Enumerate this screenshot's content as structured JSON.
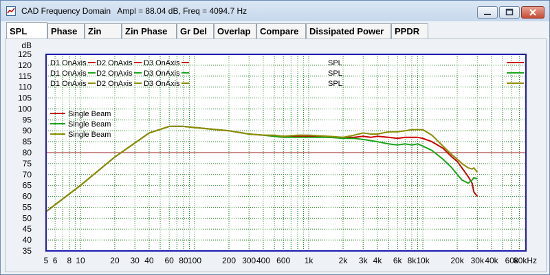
{
  "window": {
    "title": "CAD Frequency Domain   Ampl = 88.04 dB, Freq = 4094.7 Hz"
  },
  "tabs": [
    {
      "label": "SPL",
      "active": true
    },
    {
      "label": "Phase",
      "active": false
    },
    {
      "label": "Zin",
      "active": false
    },
    {
      "label": "Zin Phase",
      "active": false
    },
    {
      "label": "Gr Del",
      "active": false
    },
    {
      "label": "Overlap",
      "active": false
    },
    {
      "label": "Compare",
      "active": false
    },
    {
      "label": "Dissipated Power",
      "active": false
    },
    {
      "label": "PPDR",
      "active": false
    }
  ],
  "colors": {
    "red": "#cc0000",
    "green": "#1aa51a",
    "olive": "#8c8c00",
    "grid": "#157a15",
    "reference": "#9b1b1b",
    "frame": "#1c1cb0",
    "plot_bg": "#ffffff"
  },
  "chart_data": {
    "type": "line",
    "x_scale": "log",
    "xlim": [
      5,
      80000
    ],
    "ylim": [
      35,
      125
    ],
    "ylabel": "dB",
    "grid": true,
    "y_ticks": [
      35,
      40,
      45,
      50,
      55,
      60,
      65,
      70,
      75,
      80,
      85,
      90,
      95,
      100,
      105,
      110,
      115,
      120,
      125
    ],
    "x_tick_labels": [
      {
        "x": 5,
        "label": "5"
      },
      {
        "x": 6,
        "label": "6"
      },
      {
        "x": 8,
        "label": "8"
      },
      {
        "x": 10,
        "label": "10"
      },
      {
        "x": 20,
        "label": "20"
      },
      {
        "x": 30,
        "label": "30"
      },
      {
        "x": 40,
        "label": "40"
      },
      {
        "x": 60,
        "label": "60"
      },
      {
        "x": 80,
        "label": "80"
      },
      {
        "x": 100,
        "label": "100"
      },
      {
        "x": 200,
        "label": "200"
      },
      {
        "x": 300,
        "label": "300"
      },
      {
        "x": 400,
        "label": "400"
      },
      {
        "x": 600,
        "label": "600"
      },
      {
        "x": 1000,
        "label": "1k"
      },
      {
        "x": 2000,
        "label": "2k"
      },
      {
        "x": 3000,
        "label": "3k"
      },
      {
        "x": 4000,
        "label": "4k"
      },
      {
        "x": 6000,
        "label": "6k"
      },
      {
        "x": 8000,
        "label": "8k"
      },
      {
        "x": 10000,
        "label": "10k"
      },
      {
        "x": 20000,
        "label": "20k"
      },
      {
        "x": 30000,
        "label": "30k"
      },
      {
        "x": 40000,
        "label": "40k"
      },
      {
        "x": 60000,
        "label": "60k"
      },
      {
        "x": 80000,
        "label": "80kHz"
      }
    ],
    "reference_line": 80,
    "legend_top": [
      {
        "label": "D1 OnAxis - D2 OnAxis - D3 OnAxis",
        "right_label": "SPL",
        "color_key": "red"
      },
      {
        "label": "D1 OnAxis - D2 OnAxis - D3 OnAxis",
        "right_label": "SPL",
        "color_key": "green"
      },
      {
        "label": "D1 OnAxis - D2 OnAxis - D3 OnAxis",
        "right_label": "SPL",
        "color_key": "olive"
      }
    ],
    "legend_left": [
      {
        "label": "Single Beam",
        "color_key": "red"
      },
      {
        "label": "Single Beam",
        "color_key": "green"
      },
      {
        "label": "Single Beam",
        "color_key": "olive"
      }
    ],
    "series": [
      {
        "color_key": "red",
        "x": [
          5,
          10,
          20,
          40,
          60,
          80,
          100,
          200,
          300,
          400,
          500,
          600,
          800,
          1000,
          1500,
          2000,
          2500,
          3000,
          3500,
          4000,
          5000,
          6000,
          7000,
          8000,
          9000,
          10000,
          12000,
          15000,
          18000,
          20000,
          22000,
          25000,
          27000,
          28000,
          30000
        ],
        "y": [
          53,
          65,
          78,
          89,
          92,
          92,
          91.5,
          90,
          88.5,
          88,
          87.5,
          87,
          87.5,
          87.5,
          87,
          87,
          87,
          87.5,
          87,
          87.5,
          87,
          86.5,
          87,
          87,
          87,
          86.5,
          85,
          82,
          78,
          76,
          73,
          69,
          66,
          62,
          60
        ]
      },
      {
        "color_key": "green",
        "x": [
          5,
          10,
          20,
          40,
          60,
          80,
          100,
          200,
          300,
          400,
          500,
          600,
          800,
          1000,
          1500,
          2000,
          2500,
          3000,
          3500,
          4000,
          5000,
          6000,
          7000,
          8000,
          9000,
          10000,
          12000,
          15000,
          18000,
          20000,
          22000,
          25000,
          27000,
          28000,
          30000
        ],
        "y": [
          53,
          65,
          78,
          89,
          92,
          92,
          91.5,
          90,
          88.5,
          88,
          87.5,
          87,
          87,
          87,
          87,
          86.5,
          86.5,
          86,
          85.5,
          85,
          84,
          83.5,
          84,
          83.5,
          84,
          83,
          81,
          77,
          73,
          70,
          67.5,
          66,
          67.5,
          68.5,
          68
        ]
      },
      {
        "color_key": "olive",
        "x": [
          5,
          10,
          20,
          40,
          60,
          80,
          100,
          200,
          300,
          400,
          500,
          600,
          800,
          1000,
          1500,
          2000,
          2500,
          3000,
          3500,
          4000,
          5000,
          6000,
          7000,
          8000,
          9000,
          10000,
          12000,
          15000,
          18000,
          20000,
          22000,
          25000,
          27000,
          28000,
          30000
        ],
        "y": [
          53,
          65,
          78,
          89,
          92,
          92,
          91.5,
          90,
          88.5,
          88,
          88,
          87.5,
          88,
          88,
          87.5,
          87,
          88,
          89,
          88.5,
          88.5,
          89.5,
          89.5,
          90,
          90.5,
          90.5,
          90.5,
          88,
          83,
          79,
          77,
          75,
          73,
          72.5,
          73,
          71
        ]
      }
    ]
  }
}
